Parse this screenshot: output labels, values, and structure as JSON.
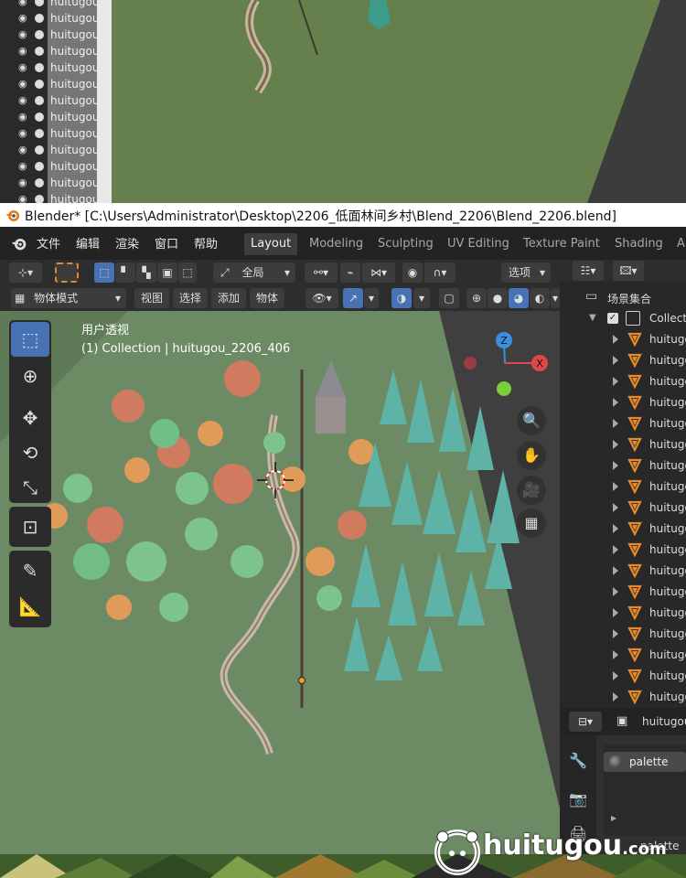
{
  "prev_outliner": {
    "rows": [
      "huitugou",
      "huitugou",
      "huitugou",
      "huitugou",
      "huitugou",
      "huitugou",
      "huitugou",
      "huitugou",
      "huitugou",
      "huitugou",
      "huitugou",
      "huitugou",
      "huitugou"
    ]
  },
  "window": {
    "title": "Blender* [C:\\Users\\Administrator\\Desktop\\2206_低面林间乡村\\Blend_2206\\Blend_2206.blend]"
  },
  "menu": {
    "items": [
      "文件",
      "编辑",
      "渲染",
      "窗口",
      "帮助"
    ]
  },
  "workspaces": {
    "tabs": [
      "Layout",
      "Modeling",
      "Sculpting",
      "UV Editing",
      "Texture Paint",
      "Shading",
      "Ai"
    ],
    "active": "Layout"
  },
  "viewport": {
    "transform_space": "全局",
    "options_label": "选项",
    "mode_label": "物体模式",
    "header_menus": [
      "视图",
      "选择",
      "添加",
      "物体"
    ],
    "view_name": "用户透视",
    "collection_info": "(1) Collection | huitugou_2206_406",
    "gizmo": {
      "z": "Z",
      "x": "X"
    }
  },
  "outliner": {
    "scene_collection": "场景集合",
    "collection": "Collection",
    "objects": [
      "huitugo",
      "huitugo",
      "huitugo",
      "huitugo",
      "huitugo",
      "huitugo",
      "huitugo",
      "huitugo",
      "huitugo",
      "huitugo",
      "huitugo",
      "huitugo",
      "huitugo",
      "huitugo",
      "huitugo",
      "huitugo",
      "huitugo",
      "huitugo"
    ]
  },
  "properties": {
    "object_name": "huitugou",
    "material": "palette",
    "material_bottom": "palette"
  },
  "watermark": {
    "brand": "huitugou",
    "suffix": ".com"
  },
  "colors": {
    "accent": "#4772b3",
    "header_bg": "#232323",
    "panel_bg": "#282828",
    "object_icon": "#e8892c"
  }
}
